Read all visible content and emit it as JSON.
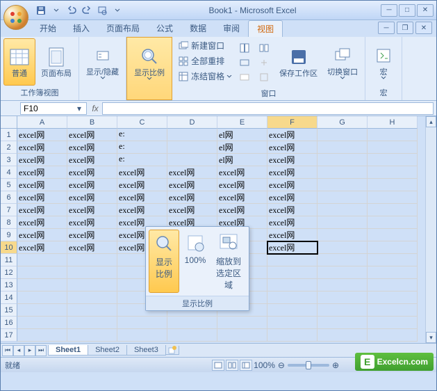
{
  "title": "Book1 - Microsoft Excel",
  "qat_tips": [
    "save",
    "undo",
    "redo",
    "print"
  ],
  "tabs": [
    "开始",
    "插入",
    "页面布局",
    "公式",
    "数据",
    "审阅",
    "视图"
  ],
  "active_tab": "视图",
  "ribbon": {
    "g1": {
      "label": "工作簿视图",
      "b1": "普通",
      "b2": "页面布局",
      "b3": "显示/隐藏",
      "b4": "显示比例"
    },
    "g2": {
      "label": "窗口",
      "s1": "新建窗口",
      "s2": "全部重排",
      "s3": "冻结窗格",
      "b1": "保存工作区",
      "b2": "切换窗口"
    },
    "g3": {
      "label": "宏",
      "b1": "宏"
    }
  },
  "zoom_popup": {
    "b1": "显示比例",
    "b2": "100%",
    "b3": "缩放到选定区域",
    "foot": "显示比例"
  },
  "namebox": "F10",
  "cols": [
    "A",
    "B",
    "C",
    "D",
    "E",
    "F",
    "G",
    "H"
  ],
  "rows_count": 17,
  "data_rows": 10,
  "data_cols": 6,
  "cell_value": "excel网",
  "popup_cells": {
    "c1r1": "e:",
    "c1r2": "e:",
    "c1r3": "e:",
    "c2r1": "el网",
    "c2r2": "el网",
    "c2r3": "el网"
  },
  "active_cell": {
    "row": 10,
    "col": 6
  },
  "highlight_col": 6,
  "highlight_row": 10,
  "sheets": [
    "Sheet1",
    "Sheet2",
    "Sheet3"
  ],
  "active_sheet": 0,
  "status": "就绪",
  "zoom": "100%",
  "watermark": "Excelcn.com"
}
